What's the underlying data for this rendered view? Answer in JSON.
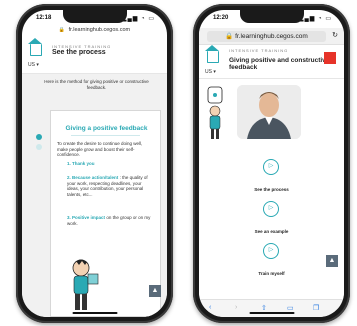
{
  "left_phone": {
    "status_time": "12:18",
    "url": "fr.learninghub.cegos.com",
    "kicker": "INTENSIVE TRAINING",
    "title": "See the process",
    "lang": "US",
    "intro": "Here is the method for giving positive or constructive feedback.",
    "step_number": "1",
    "card_title": "Giving a positive feedback",
    "card_text": "To create the desire to continue doing well, make people grow and boost their self-confidence.",
    "points": [
      {
        "num": "1.",
        "head": "Thank you",
        "body": ""
      },
      {
        "num": "2.",
        "head": "Because action/talent",
        "body": ": the quality of your work, respecting deadlines, your ideas, your contribution, your personal talents, etc..."
      },
      {
        "num": "3.",
        "head": "Positive impact",
        "body": "on the group or on my work."
      }
    ]
  },
  "right_phone": {
    "status_time": "12:20",
    "url": "fr.learninghub.cegos.com",
    "kicker": "INTENSIVE TRAINING",
    "title": "Giving positive and constructive feedback",
    "lang": "US",
    "actions": [
      {
        "label": "See the process",
        "icon": "play-icon"
      },
      {
        "label": "See an example",
        "icon": "play-icon"
      },
      {
        "label": "Train myself",
        "icon": "play-icon"
      }
    ]
  },
  "colors": {
    "accent": "#2aa9b4",
    "logo": "#e63329",
    "ios_blue": "#2f7de1"
  }
}
